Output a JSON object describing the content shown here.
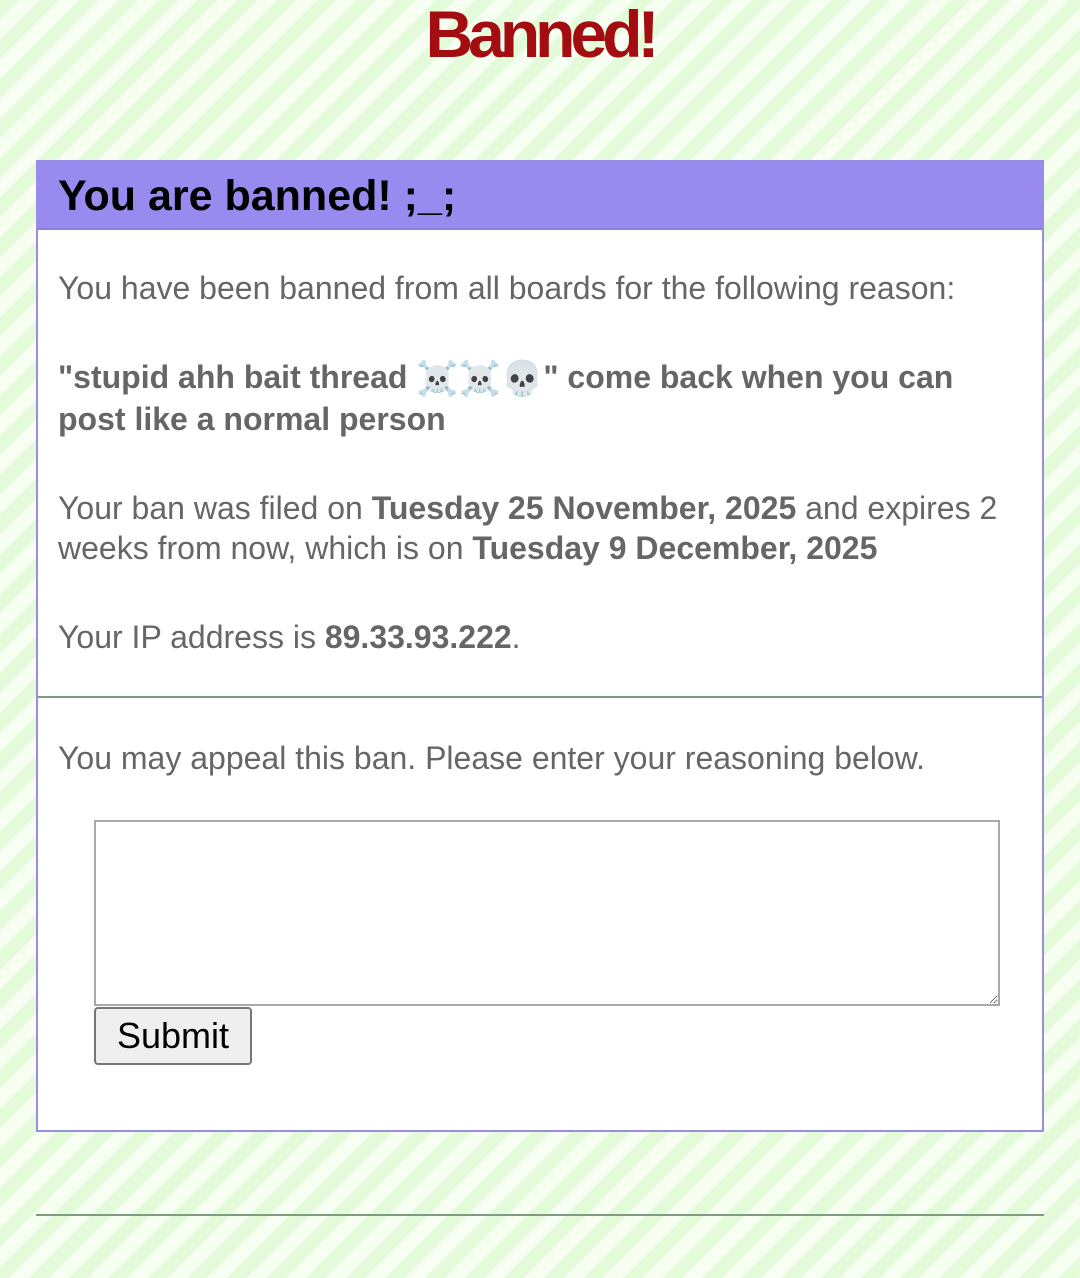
{
  "page": {
    "title": "Banned!"
  },
  "ban": {
    "header": "You are banned! ;_;",
    "intro": "You have been banned from all boards for the following reason:",
    "reason_open": "\"stupid ahh bait thread ",
    "reason_emojis": [
      "☠️",
      "☠️",
      "💀"
    ],
    "reason_close": "\" come back when you can post like a normal person",
    "filed_prefix": "Your ban was filed on ",
    "filed_date": "Tuesday 25 November, 2025",
    "expires_middle": " and expires 2 weeks from now, which is on ",
    "expires_date": "Tuesday 9 December, 2025",
    "ip_prefix": "Your IP address is ",
    "ip_address": "89.33.93.222",
    "ip_suffix": "."
  },
  "appeal": {
    "prompt": "You may appeal this ban. Please enter your reasoning below.",
    "reasoning_value": "",
    "submit_label": "Submit"
  },
  "colors": {
    "title_red": "#a30d12",
    "header_purple": "#988aee",
    "background_green": "#e4fbd9",
    "text_gray": "#666666"
  }
}
